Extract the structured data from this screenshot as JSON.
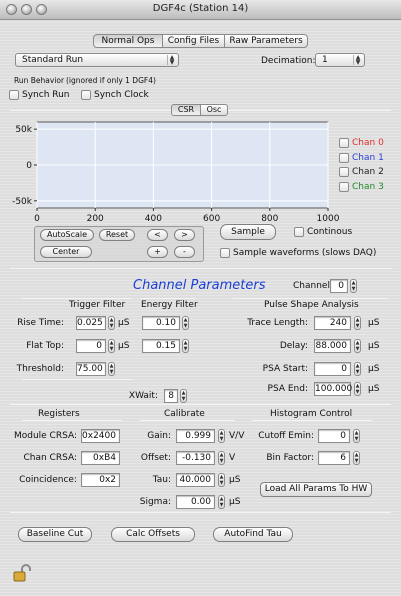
{
  "window": {
    "title": "DGF4c (Station 14)"
  },
  "tabs": [
    {
      "label": "Normal Ops",
      "selected": true
    },
    {
      "label": "Config Files",
      "selected": false
    },
    {
      "label": "Raw Parameters",
      "selected": false
    }
  ],
  "run": {
    "type_value": "Standard Run",
    "decimation_label": "Decimation:",
    "decimation_value": "1",
    "behavior_label": "Run Behavior",
    "behavior_note": "(ignored if only 1 DGF4)",
    "synch_run_label": "Synch Run",
    "synch_clock_label": "Synch Clock"
  },
  "view_tabs": [
    {
      "label": "CSR",
      "selected": true
    },
    {
      "label": "Osc",
      "selected": false
    }
  ],
  "chart_data": {
    "type": "line",
    "x_ticks": [
      "0",
      "200",
      "400",
      "600",
      "800",
      "1000"
    ],
    "y_ticks": [
      "50k",
      "0",
      "-50k"
    ],
    "xlim": [
      0,
      1000
    ],
    "ylim": [
      -60000,
      60000
    ],
    "series": [],
    "legend": [
      {
        "name": "Chan 0",
        "color": "#e03030"
      },
      {
        "name": "Chan 1",
        "color": "#2b3fd6"
      },
      {
        "name": "Chan 2",
        "color": "#222222"
      },
      {
        "name": "Chan 3",
        "color": "#1f8a2a"
      }
    ]
  },
  "plot_controls": {
    "autoscale": "AutoScale",
    "reset": "Reset",
    "center": "Center",
    "left": "<",
    "right": ">",
    "plus": "+",
    "minus": "-",
    "sample": "Sample",
    "continuous": "Continous",
    "sample_waveforms": "Sample waveforms (slows DAQ)"
  },
  "channel_params": {
    "heading": "Channel Parameters",
    "heading_color": "#1a3fd6",
    "channel_label": "Channel:",
    "channel_value": "0",
    "trigger_filter": "Trigger Filter",
    "energy_filter": "Energy Filter",
    "pulse_shape": "Pulse Shape Analysis",
    "rise_time_label": "Rise Time:",
    "rise_time_trigger": "0.025",
    "rise_time_energy": "0.10",
    "flat_top_label": "Flat Top:",
    "flat_top_trigger": "0",
    "flat_top_energy": "0.15",
    "threshold_label": "Threshold:",
    "threshold_value": "75.00",
    "us": "µS",
    "trace_length_label": "Trace Length:",
    "trace_length_value": "240",
    "delay_label": "Delay:",
    "delay_value": "88.000",
    "psa_start_label": "PSA Start:",
    "psa_start_value": "0",
    "psa_end_label": "PSA End:",
    "psa_end_value": "100.000",
    "xwait_label": "XWait:",
    "xwait_value": "8"
  },
  "registers": {
    "heading": "Registers",
    "module_csra_label": "Module CRSA:",
    "module_csra_value": "0x2400",
    "chan_csra_label": "Chan CRSA:",
    "chan_csra_value": "0xB4",
    "coincidence_label": "Coincidence:",
    "coincidence_value": "0x2"
  },
  "calibrate": {
    "heading": "Calibrate",
    "gain_label": "Gain:",
    "gain_value": "0.999",
    "gain_unit": "V/V",
    "offset_label": "Offset:",
    "offset_value": "-0.130",
    "offset_unit": "V",
    "tau_label": "Tau:",
    "tau_value": "40.000",
    "tau_unit": "µS",
    "sigma_label": "Sigma:",
    "sigma_value": "0.00",
    "sigma_unit": "µS"
  },
  "histogram": {
    "heading": "Histogram Control",
    "cutoff_label": "Cutoff Emin:",
    "cutoff_value": "0",
    "bin_factor_label": "Bin Factor:",
    "bin_factor_value": "6",
    "load_all": "Load All Params To HW"
  },
  "bottom_buttons": {
    "baseline_cut": "Baseline Cut",
    "calc_offsets": "Calc Offsets",
    "autofind_tau": "AutoFind Tau"
  }
}
